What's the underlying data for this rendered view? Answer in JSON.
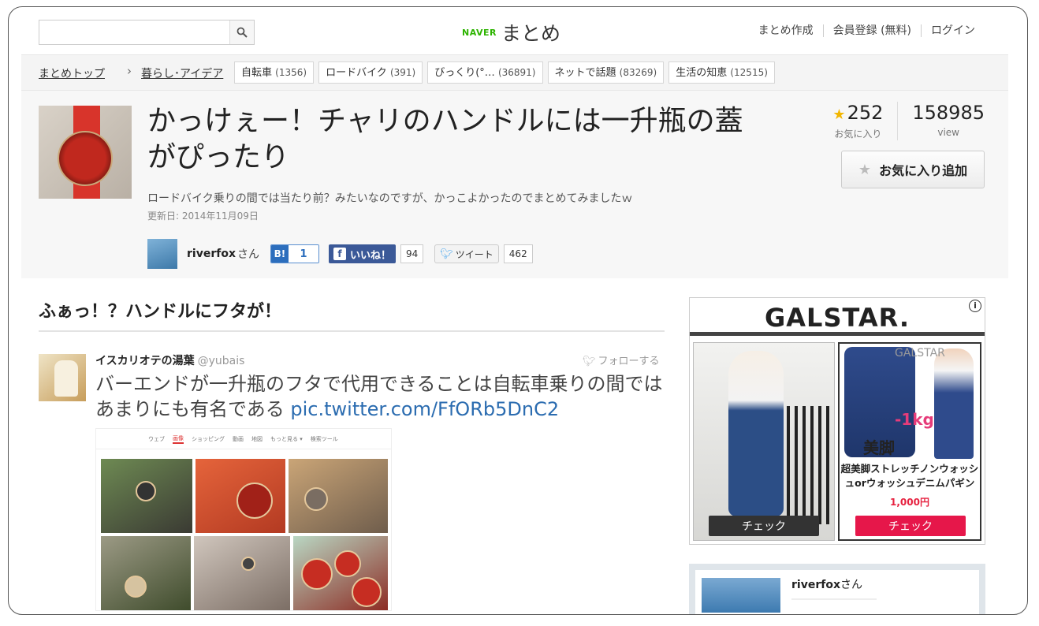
{
  "header": {
    "search_placeholder": "",
    "logo_naver": "NAVER",
    "logo_matome": "まとめ",
    "links": [
      "まとめ作成",
      "会員登録 (無料)",
      "ログイン"
    ]
  },
  "breadcrumb": {
    "top": "まとめトップ",
    "separator": "›",
    "category": "暮らし･アイデア",
    "tags": [
      {
        "label": "自転車",
        "count": "(1356)"
      },
      {
        "label": "ロードバイク",
        "count": "(391)"
      },
      {
        "label": "びっくり(°…",
        "count": "(36891)"
      },
      {
        "label": "ネットで話題",
        "count": "(83269)"
      },
      {
        "label": "生活の知恵",
        "count": "(12515)"
      }
    ]
  },
  "article": {
    "title": "かっけぇー！チャリのハンドルには一升瓶の蓋がぴったり",
    "description": "ロードバイク乗りの間では当たり前？みたいなのですが、かっこよかったのでまとめてみましたｗ",
    "updated": "更新日: 2014年11月09日",
    "author": "riverfox",
    "author_suffix": "さん",
    "favorites": "252",
    "favorites_label": "お気に入り",
    "views": "158985",
    "views_label": "view",
    "fav_button": "お気に入り追加",
    "share": {
      "hatena_icon": "B!",
      "hatena_count": "1",
      "fb_icon": "f",
      "fb_label": "いいね！",
      "fb_count": "94",
      "tw_label": "ツイート",
      "tw_count": "462"
    }
  },
  "content": {
    "section_title": "ふぁっ！？ハンドルにフタが！",
    "tweet": {
      "user_name": "イスカリオテの湯葉",
      "handle": "@yubais",
      "follow": "フォローする",
      "text": "バーエンドが一升瓶のフタで代用できることは自転車乗りの間ではあまりにも有名である ",
      "link": "pic.twitter.com/FfORb5DnC2",
      "image_nav": [
        "ウェブ",
        "画像",
        "ショッピング",
        "動画",
        "地図",
        "もっと見る ▾",
        "検索ツール"
      ]
    }
  },
  "ad": {
    "brand": "GALSTAR.",
    "info_icon": "i",
    "right_brand": "GALSTAR",
    "kg_label": "-1kg",
    "bikyaku": "美脚",
    "product": "超美脚ストレッチノンウォッシュorウォッシュデニムパギン",
    "price": "1,000円",
    "check_left": "チェック",
    "check_right": "チェック"
  },
  "author_card": {
    "name": "riverfox",
    "suffix": "さん"
  },
  "colors": {
    "naver_green": "#2db400",
    "link_blue": "#2b6cb0",
    "fb_blue": "#3b5998",
    "ad_red": "#e6174a",
    "star_gold": "#f2b600"
  }
}
